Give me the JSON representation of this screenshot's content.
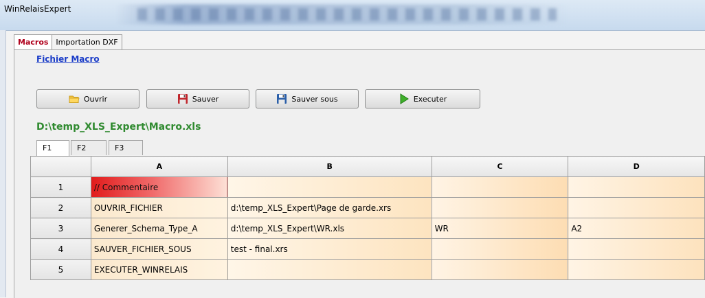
{
  "window": {
    "title": "WinRelaisExpert"
  },
  "main_tabs": [
    {
      "label": "Macros",
      "active": true
    },
    {
      "label": "Importation DXF",
      "active": false
    }
  ],
  "fichier_macro": {
    "label": "Fichier Macro"
  },
  "toolbar": {
    "open_label": "Ouvrir",
    "save_label": "Sauver",
    "save_as_label": "Sauver sous",
    "execute_label": "Executer"
  },
  "file_path": "D:\\temp_XLS_Expert\\Macro.xls",
  "sheet_tabs": [
    {
      "label": "F1",
      "active": true
    },
    {
      "label": "F2",
      "active": false
    },
    {
      "label": "F3",
      "active": false
    }
  ],
  "grid": {
    "columns": [
      "A",
      "B",
      "C",
      "D"
    ],
    "rows": [
      {
        "num": "1",
        "A": "// Commentaire",
        "B": "",
        "C": "",
        "D": ""
      },
      {
        "num": "2",
        "A": "OUVRIR_FICHIER",
        "B": "d:\\temp_XLS_Expert\\Page de garde.xrs",
        "C": "",
        "D": ""
      },
      {
        "num": "3",
        "A": "Generer_Schema_Type_A",
        "B": "d:\\temp_XLS_Expert\\WR.xls",
        "C": "WR",
        "D": "A2"
      },
      {
        "num": "4",
        "A": "SAUVER_FICHIER_SOUS",
        "B": "test - final.xrs",
        "C": "",
        "D": ""
      },
      {
        "num": "5",
        "A": "EXECUTER_WINRELAIS",
        "B": "",
        "C": "",
        "D": ""
      }
    ]
  },
  "colors": {
    "active_tab_text": "#b0001c",
    "link": "#1a3cc8",
    "path_text": "#2f8a2f",
    "comment_cell": "#e11b1b",
    "cell_fill": "#fde4c0"
  }
}
